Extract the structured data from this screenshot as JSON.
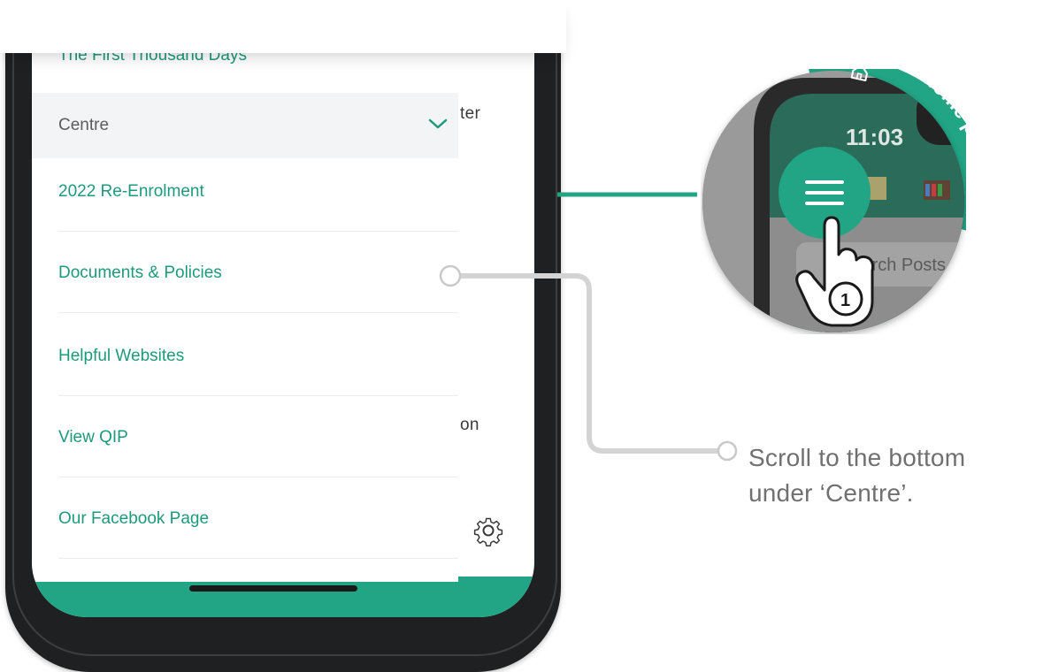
{
  "drawer": {
    "top_item": "The First Thousand Days",
    "section_label": "Centre",
    "items": [
      {
        "label": "2022 Re-Enrolment"
      },
      {
        "label": "Documents & Policies"
      },
      {
        "label": "Helpful Websites"
      },
      {
        "label": "View QIP"
      },
      {
        "label": "Our Facebook Page"
      }
    ]
  },
  "behind_screen": {
    "text_1": "ter",
    "text_2": "on"
  },
  "callout": {
    "line_1": "Scroll to the bottom",
    "line_2": "under ‘Centre’."
  },
  "zoom": {
    "time": "11:03",
    "search_placeholder": "Search Posts",
    "step_number": "1",
    "ribbon_text": "from home page"
  },
  "colors": {
    "brand_green": "#21a585",
    "text_green": "#1d9a7c",
    "callout_gray": "#707070"
  },
  "icons": {
    "chevron": "chevron-down-icon",
    "gear": "gear-icon",
    "menu": "hamburger-menu-icon",
    "hand": "pointing-hand-icon",
    "home": "home-icon"
  }
}
